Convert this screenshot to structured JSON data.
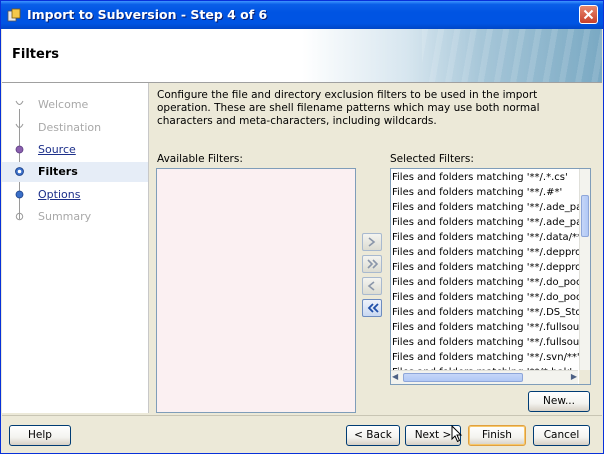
{
  "window": {
    "title": "Import to Subversion - Step 4 of 6"
  },
  "header": {
    "title": "Filters"
  },
  "steps": [
    {
      "label": "Welcome",
      "state": "disabled"
    },
    {
      "label": "Destination",
      "state": "disabled"
    },
    {
      "label": "Source",
      "state": "link"
    },
    {
      "label": "Filters",
      "state": "current"
    },
    {
      "label": "Options",
      "state": "link"
    },
    {
      "label": "Summary",
      "state": "disabled"
    }
  ],
  "content": {
    "description": "Configure the file and directory exclusion filters to be used in the import operation. These are shell filename patterns which may use both normal characters and meta-characters, including wildcards.",
    "available_label": "Available Filters:",
    "selected_label": "Selected Filters:",
    "selected_filters": [
      "Files and folders matching '**/.*.cs'",
      "Files and folders matching '**/.#*'",
      "Files and folders matching '**/.ade_path'",
      "Files and folders matching '**/.ade_path/",
      "Files and folders matching '**/.data/**'",
      "Files and folders matching '**/.depprod'",
      "Files and folders matching '**/.depprod_r",
      "Files and folders matching '**/.do_pool'",
      "Files and folders matching '**/.do_pool/*",
      "Files and folders matching '**/.DS_Store'",
      "Files and folders matching '**/.fullsource'",
      "Files and folders matching '**/.fullsource_",
      "Files and folders matching '**/.svn/**'",
      "Files and folders matching '**/*.bak'"
    ],
    "new_button": "New..."
  },
  "footer": {
    "help": "Help",
    "back": "< Back",
    "next": "Next >",
    "finish": "Finish",
    "cancel": "Cancel"
  },
  "colors": {
    "titlebar": "#0054e3",
    "dialog_bg": "#ece9d8",
    "available_bg": "#fbf0f2",
    "current_step_bg": "#e6edf7"
  }
}
